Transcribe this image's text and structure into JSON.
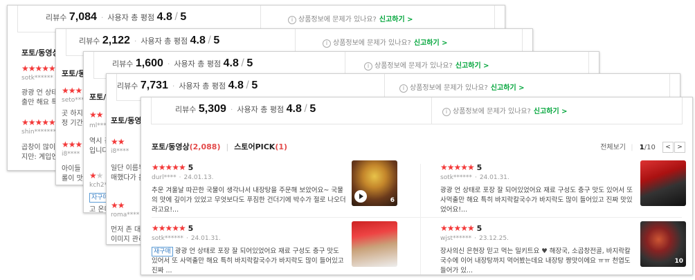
{
  "common": {
    "reviews_label": "리뷰수",
    "avg_label": "사용자 총 평점",
    "rating": "4.8",
    "rating_max": "5",
    "report_q": "상품정보에 문제가 있나요?",
    "report_link": "신고하기 >",
    "photo_tab": "포토/동영상"
  },
  "layers": [
    {
      "review_count": "7,084",
      "stubs": [
        "sotk******",
        "광광 언 상태로",
        "출만 해요 특히",
        "shin*******",
        "곱창이 많이들",
        "지만: 계입엔 간"
      ]
    },
    {
      "review_count": "2,122",
      "stubs": [
        "seto*****",
        "곳 하지만",
        "정 기간 이",
        "i8****",
        "아이들 먹",
        "롤이 맛있"
      ]
    },
    {
      "review_count": "1,600",
      "stubs": [
        "ml****",
        "역시 김",
        "입니다",
        "kch2**",
        "자구매",
        "고 온다"
      ]
    },
    {
      "review_count": "7,731",
      "stubs": [
        "i8****",
        "일단 이름부",
        "매했다가 음",
        "roma****",
        "먼저 존 대로",
        "이미지 관리"
      ]
    }
  ],
  "front": {
    "review_count": "5,309",
    "photo_tab_count": "(2,088)",
    "store_tab": "스토어PICK",
    "store_tab_count": "(1)",
    "view_all": "전체보기",
    "page_current": "1",
    "page_total": "/10",
    "reviews": [
      {
        "stars": "★★★★★",
        "score": "5",
        "user": "durl****",
        "date": "24.01.13.",
        "badge": "",
        "text": "추운 겨울날 따끈한 국물이 생각나서 내장탕을 주문해 보았어요~ 국물의 맛에 깊이가 있었고 무엇보다도 푸짐한 건더기에 박수가 절로 나오더라고요!...",
        "count": "6",
        "video": true
      },
      {
        "stars": "★★★★★",
        "score": "5",
        "user": "sotk******",
        "date": "24.01.31.",
        "badge": "",
        "text": "광광 언 상태로 포장 잘 되어있었어요 재료 구성도 충구 맛도 있어서 또 사먹출만 해요 특히 바지락칼국수가 바지락도 많이 들어있고 진짜 맛있었어요!...",
        "count": "",
        "video": false
      },
      {
        "stars": "★★★★★",
        "score": "5",
        "user": "sotk******",
        "date": "24.01.31.",
        "badge": "재구매",
        "text": "광광 언 상태로 포장 잘 되어있었어요 재료 구성도 충구 맛도 있어서 또 사먹출만 해요 특히 바지락칼국수가 바지락도 많이 들어있고 진짜 ...",
        "count": "",
        "video": false
      },
      {
        "stars": "★★★★★",
        "score": "5",
        "user": "wjst******",
        "date": "23.12.25.",
        "badge": "",
        "text": "장사의신 은현장 믿고 먹는 밀키트요 ♥ 해장국, 소곱창전골, 바지락칼국수에 이어 내장탕까지 먹어봤는데요 내장탕 짱맛이에요 ㅠㅠ 천엽도 들어가 있...",
        "count": "10",
        "video": false
      }
    ]
  }
}
